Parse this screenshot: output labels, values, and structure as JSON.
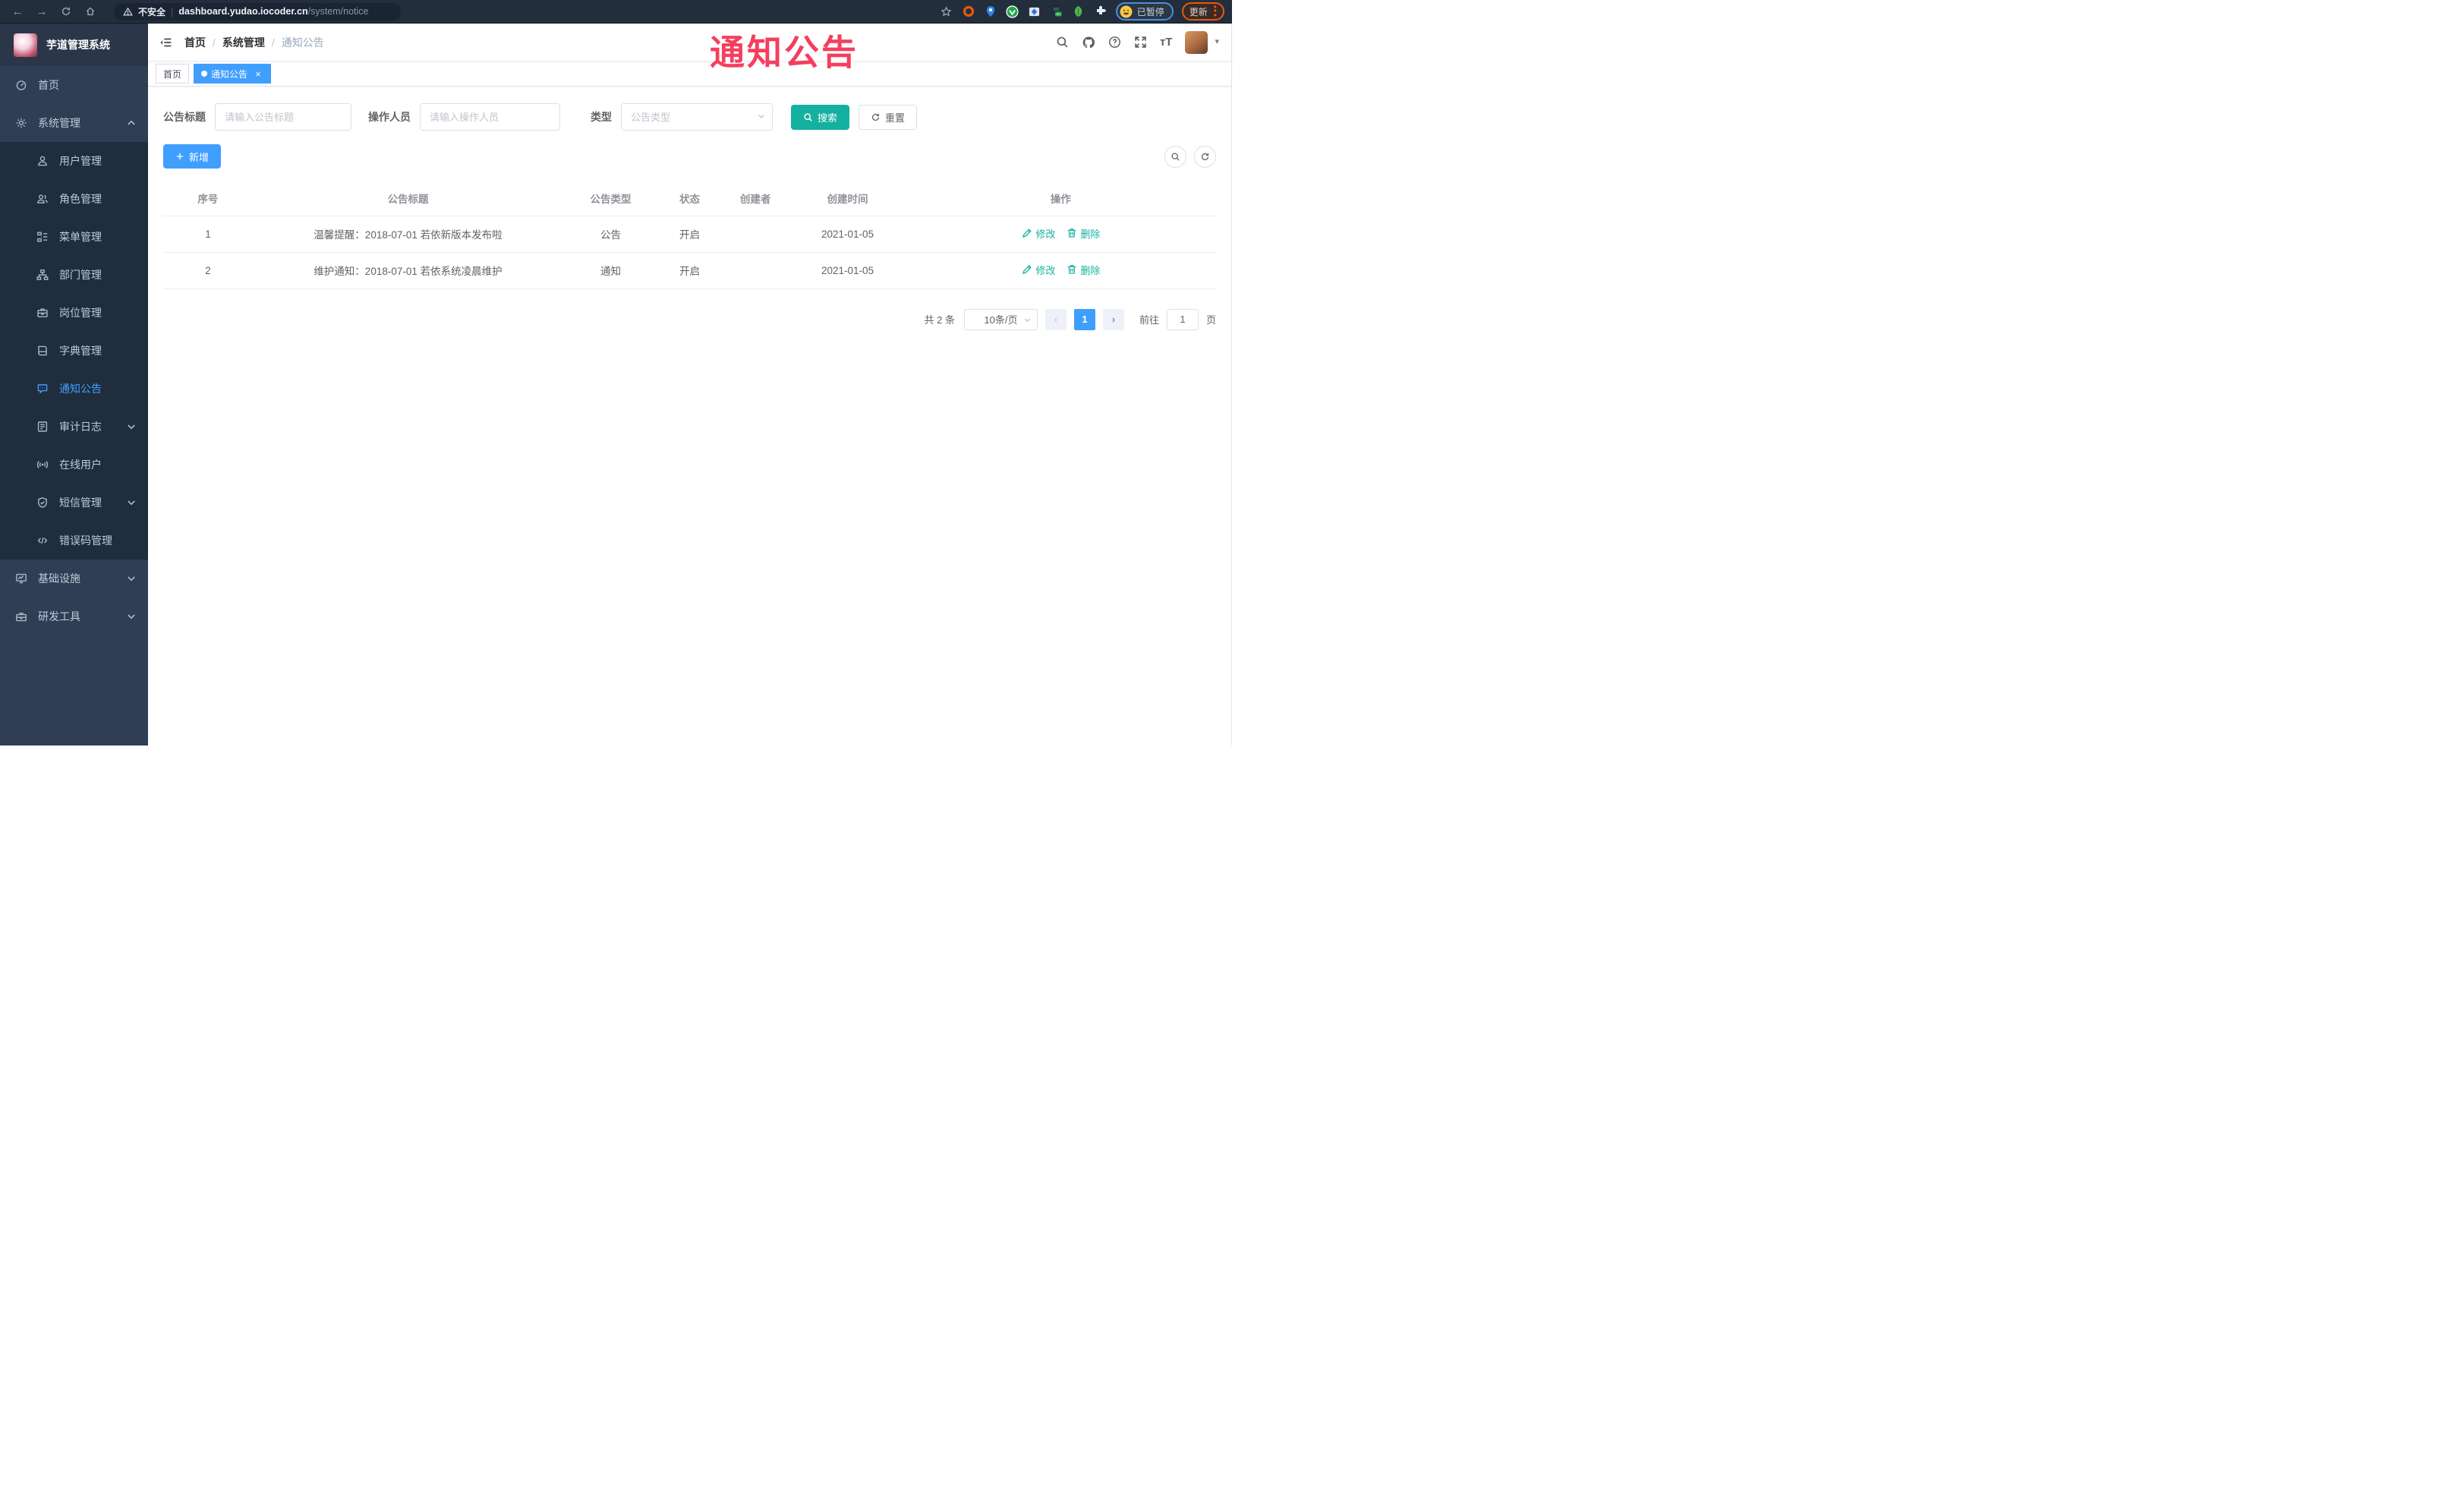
{
  "browser": {
    "security_label": "不安全",
    "url_host": "dashboard.yudao.iocoder.cn",
    "url_path": "/system/notice",
    "profile_label": "已暂停",
    "update_label": "更新",
    "extensions": [
      "orange-ring-extension-icon",
      "location-pin-extension-icon",
      "green-circle-extension-icon",
      "blue-diamond-extension-icon",
      "switch-on-extension-icon",
      "green-leaf-extension-icon",
      "puzzle-extensions-icon"
    ]
  },
  "watermark": {
    "text": "通知公告"
  },
  "sidebar": {
    "title": "芋道管理系统",
    "items": [
      {
        "label": "首页",
        "icon": "dashboard-icon",
        "level": 1,
        "active": false,
        "chevron": ""
      },
      {
        "label": "系统管理",
        "icon": "gear-icon",
        "level": 1,
        "active": false,
        "chevron": "up"
      },
      {
        "label": "用户管理",
        "icon": "user-icon",
        "level": 2,
        "active": false,
        "chevron": ""
      },
      {
        "label": "角色管理",
        "icon": "roles-icon",
        "level": 2,
        "active": false,
        "chevron": ""
      },
      {
        "label": "菜单管理",
        "icon": "menu-tree-icon",
        "level": 2,
        "active": false,
        "chevron": ""
      },
      {
        "label": "部门管理",
        "icon": "org-tree-icon",
        "level": 2,
        "active": false,
        "chevron": ""
      },
      {
        "label": "岗位管理",
        "icon": "post-icon",
        "level": 2,
        "active": false,
        "chevron": ""
      },
      {
        "label": "字典管理",
        "icon": "dict-icon",
        "level": 2,
        "active": false,
        "chevron": ""
      },
      {
        "label": "通知公告",
        "icon": "message-icon",
        "level": 2,
        "active": true,
        "chevron": ""
      },
      {
        "label": "审计日志",
        "icon": "log-icon",
        "level": 2,
        "active": false,
        "chevron": "down"
      },
      {
        "label": "在线用户",
        "icon": "online-user-icon",
        "level": 2,
        "active": false,
        "chevron": ""
      },
      {
        "label": "短信管理",
        "icon": "sms-shield-icon",
        "level": 2,
        "active": false,
        "chevron": "down"
      },
      {
        "label": "错误码管理",
        "icon": "code-icon",
        "level": 2,
        "active": false,
        "chevron": ""
      },
      {
        "label": "基础设施",
        "icon": "infra-icon",
        "level": 1,
        "active": false,
        "chevron": "down"
      },
      {
        "label": "研发工具",
        "icon": "tools-icon",
        "level": 1,
        "active": false,
        "chevron": "down"
      }
    ]
  },
  "header": {
    "breadcrumb": [
      "首页",
      "系统管理",
      "通知公告"
    ],
    "separator": "/"
  },
  "tags": [
    {
      "label": "首页",
      "active": false
    },
    {
      "label": "通知公告",
      "active": true
    }
  ],
  "filters": {
    "title_label": "公告标题",
    "title_placeholder": "请输入公告标题",
    "operator_label": "操作人员",
    "operator_placeholder": "请输入操作人员",
    "type_label": "类型",
    "type_placeholder": "公告类型",
    "search_label": "搜索",
    "reset_label": "重置"
  },
  "toolbar": {
    "add_label": "新增"
  },
  "table": {
    "headers": [
      "序号",
      "公告标题",
      "公告类型",
      "状态",
      "创建者",
      "创建时间",
      "操作"
    ],
    "col_widths": [
      "8.5%",
      "29.5%",
      "9%",
      "6%",
      "6.5%",
      "11%",
      "29.5%"
    ],
    "edit_label": "修改",
    "delete_label": "删除",
    "rows": [
      {
        "no": "1",
        "title": "温馨提醒：2018-07-01 若依新版本发布啦",
        "type": "公告",
        "status": "开启",
        "creator": "",
        "created": "2021-01-05"
      },
      {
        "no": "2",
        "title": "维护通知：2018-07-01 若依系统凌晨维护",
        "type": "通知",
        "status": "开启",
        "creator": "",
        "created": "2021-01-05"
      }
    ]
  },
  "pagination": {
    "total_text": "共 2 条",
    "page_size": "10条/页",
    "current_page": "1",
    "goto_label": "前往",
    "goto_value": "1",
    "page_unit": "页"
  },
  "colors": {
    "primary": "#409eff",
    "teal": "#14b0a0",
    "watermark": "#f43f5e",
    "sidebar": "#2f3e54",
    "submenu": "#1f2d3d"
  }
}
